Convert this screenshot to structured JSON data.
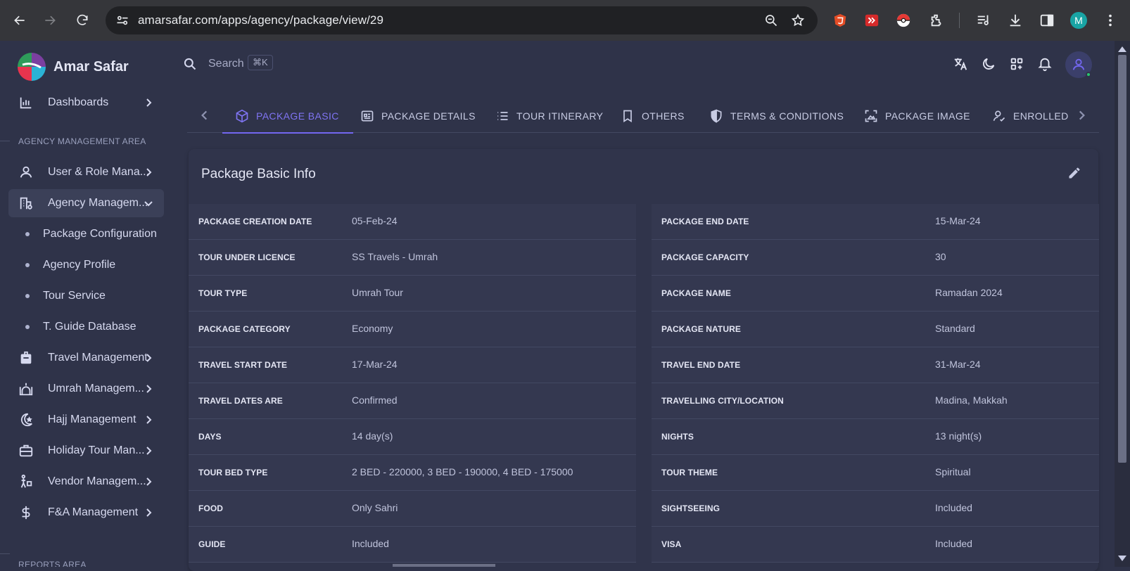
{
  "browser": {
    "url": "amarsafar.com/apps/agency/package/view/29",
    "profile_initial": "M"
  },
  "sidebar": {
    "brand": "Amar Safar",
    "dashboards": "Dashboards",
    "section_agency": "AGENCY MANAGEMENT AREA",
    "items": [
      {
        "label": "User & Role Mana...",
        "icon": "user-icon"
      },
      {
        "label": "Agency Managem...",
        "icon": "building-icon"
      }
    ],
    "sub_items": [
      "Package Configuration",
      "Agency Profile",
      "Tour Service",
      "T. Guide Database"
    ],
    "more_items": [
      {
        "label": "Travel Management",
        "icon": "luggage-icon"
      },
      {
        "label": "Umrah Managem...",
        "icon": "mosque-icon"
      },
      {
        "label": "Hajj Management",
        "icon": "crescent-icon"
      },
      {
        "label": "Holiday Tour Man...",
        "icon": "briefcase-icon"
      },
      {
        "label": "Vendor Managem...",
        "icon": "vendor-icon"
      },
      {
        "label": "F&A Management",
        "icon": "dollar-icon"
      }
    ],
    "section_reports": "REPORTS AREA"
  },
  "topbar": {
    "search_label": "Search",
    "shortcut": "⌘K"
  },
  "tabs": [
    "PACKAGE BASIC",
    "PACKAGE DETAILS",
    "TOUR ITINERARY",
    "OTHERS",
    "TERMS & CONDITIONS",
    "PACKAGE IMAGE",
    "ENROLLED"
  ],
  "card": {
    "title": "Package Basic Info",
    "left_rows": [
      {
        "key": "PACKAGE CREATION DATE",
        "value": "05-Feb-24"
      },
      {
        "key": "TOUR UNDER LICENCE",
        "value": "SS Travels - Umrah"
      },
      {
        "key": "TOUR TYPE",
        "value": "Umrah Tour"
      },
      {
        "key": "PACKAGE CATEGORY",
        "value": "Economy"
      },
      {
        "key": "TRAVEL START DATE",
        "value": "17-Mar-24"
      },
      {
        "key": "TRAVEL DATES ARE",
        "value": "Confirmed"
      },
      {
        "key": "DAYS",
        "value": "14 day(s)"
      },
      {
        "key": "TOUR BED TYPE",
        "value": "2 BED - 220000, 3 BED - 190000, 4 BED - 175000"
      },
      {
        "key": "FOOD",
        "value": "Only Sahri"
      },
      {
        "key": "GUIDE",
        "value": "Included"
      }
    ],
    "right_rows": [
      {
        "key": "PACKAGE END DATE",
        "value": "15-Mar-24"
      },
      {
        "key": "PACKAGE CAPACITY",
        "value": "30"
      },
      {
        "key": "PACKAGE NAME",
        "value": "Ramadan 2024"
      },
      {
        "key": "PACKAGE NATURE",
        "value": "Standard"
      },
      {
        "key": "TRAVEL END DATE",
        "value": "31-Mar-24"
      },
      {
        "key": "TRAVELLING CITY/LOCATION",
        "value": "Madina, Makkah"
      },
      {
        "key": "NIGHTS",
        "value": "13 night(s)"
      },
      {
        "key": "TOUR THEME",
        "value": "Spiritual"
      },
      {
        "key": "SIGHTSEEING",
        "value": "Included"
      },
      {
        "key": "VISA",
        "value": "Included"
      }
    ]
  },
  "colors": {
    "background": "#2f3349",
    "accent": "#7367f0",
    "online": "#28c76f"
  }
}
